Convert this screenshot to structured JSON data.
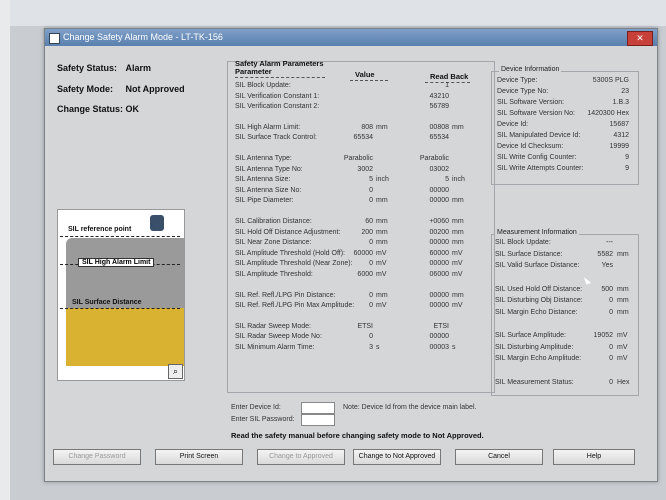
{
  "window": {
    "title": "Change Safety Alarm Mode - LT-TK-156",
    "close_icon": "close-icon"
  },
  "status": [
    {
      "label": "Safety Status:",
      "value": "Alarm"
    },
    {
      "label": "Safety Mode:",
      "value": "Not Approved"
    },
    {
      "label": "Change Status:",
      "value": "OK"
    }
  ],
  "diagram": {
    "ref_point": "SIL reference point",
    "high_alarm": "SIL High Alarm Limit",
    "surface_distance": "SIL Surface Distance",
    "icon": "magnifier-icon"
  },
  "params": {
    "group_title": "Safety Alarm Parameters",
    "col_param": "Parameter",
    "col_value": "Value",
    "col_readback": "Read Back",
    "rows": [
      {
        "p": "SIL Block Update:",
        "v": "",
        "u": "",
        "r": "1",
        "ru": ""
      },
      {
        "p": "SIL Verification Constant 1:",
        "v": "",
        "u": "",
        "r": "43210",
        "ru": ""
      },
      {
        "p": "SIL Verification Constant 2:",
        "v": "",
        "u": "",
        "r": "56789",
        "ru": ""
      },
      {
        "p": "SIL High Alarm Limit:",
        "v": "808",
        "u": "mm",
        "r": "00808",
        "ru": "mm"
      },
      {
        "p": "SIL Surface Track Control:",
        "v": "65534",
        "u": "",
        "r": "65534",
        "ru": ""
      },
      {
        "p": "SIL Antenna Type:",
        "v": "Parabolic",
        "u": "",
        "r": "Parabolic",
        "ru": ""
      },
      {
        "p": "SIL Antenna Type No:",
        "v": "3002",
        "u": "",
        "r": "03002",
        "ru": ""
      },
      {
        "p": "SIL Antenna Size:",
        "v": "5",
        "u": "inch",
        "r": "5",
        "ru": "inch"
      },
      {
        "p": "SIL Antenna Size No:",
        "v": "0",
        "u": "",
        "r": "00000",
        "ru": ""
      },
      {
        "p": "SIL Pipe Diameter:",
        "v": "0",
        "u": "mm",
        "r": "00000",
        "ru": "mm"
      },
      {
        "p": "SIL Calibration Distance:",
        "v": "60",
        "u": "mm",
        "r": "+0060",
        "ru": "mm"
      },
      {
        "p": "SIL Hold Off Distance Adjustment:",
        "v": "200",
        "u": "mm",
        "r": "00200",
        "ru": "mm"
      },
      {
        "p": "SIL Near Zone Distance:",
        "v": "0",
        "u": "mm",
        "r": "00000",
        "ru": "mm"
      },
      {
        "p": "SIL Amplitude Threshold (Hold Off):",
        "v": "60000",
        "u": "mV",
        "r": "60000",
        "ru": "mV"
      },
      {
        "p": "SIL Amplitude Threshold (Near Zone):",
        "v": "0",
        "u": "mV",
        "r": "00000",
        "ru": "mV"
      },
      {
        "p": "SIL Amplitude Threshold:",
        "v": "6000",
        "u": "mV",
        "r": "06000",
        "ru": "mV"
      },
      {
        "p": "SIL Ref. Refl./LPG Pin Distance:",
        "v": "0",
        "u": "mm",
        "r": "00000",
        "ru": "mm"
      },
      {
        "p": "SIL Ref. Refl./LPG Pin Max Amplitude:",
        "v": "0",
        "u": "mV",
        "r": "00000",
        "ru": "mV"
      },
      {
        "p": "SIL Radar Sweep Mode:",
        "v": "ETSI",
        "u": "",
        "r": "ETSI",
        "ru": ""
      },
      {
        "p": "SIL Radar Sweep Mode No:",
        "v": "0",
        "u": "",
        "r": "00000",
        "ru": ""
      },
      {
        "p": "SIL Minimum Alarm Time:",
        "v": "3",
        "u": "s",
        "r": "00003",
        "ru": "s"
      }
    ]
  },
  "device": {
    "group_title": "Device Information",
    "rows": [
      {
        "p": "Device Type:",
        "v": "5300S PLG"
      },
      {
        "p": "Device Type No:",
        "v": "23"
      },
      {
        "p": "SIL Software Version:",
        "v": "1.B.3"
      },
      {
        "p": "SIL Software Version No:",
        "v": "1420300 Hex"
      },
      {
        "p": "Device Id:",
        "v": "15687"
      },
      {
        "p": "SIL Manipulated Device Id:",
        "v": "4312"
      },
      {
        "p": "Device Id Checksum:",
        "v": "19999"
      },
      {
        "p": "SIL Write Config Counter:",
        "v": "9"
      },
      {
        "p": "SIL Write Attempts Counter:",
        "v": "9"
      }
    ]
  },
  "measurement": {
    "group_title": "Measurement Information",
    "rows": [
      {
        "p": "SIL Block Update:",
        "v": "---",
        "u": ""
      },
      {
        "p": "SIL Surface Distance:",
        "v": "5582",
        "u": "mm"
      },
      {
        "p": "SIL Valid Surface Distance:",
        "v": "Yes",
        "u": ""
      },
      {
        "p": "SIL Used Hold Off Distance:",
        "v": "500",
        "u": "mm"
      },
      {
        "p": "SIL Disturbing Obj Distance:",
        "v": "0",
        "u": "mm"
      },
      {
        "p": "SIL Margin Echo Distance:",
        "v": "0",
        "u": "mm"
      },
      {
        "p": "SIL Surface Amplitude:",
        "v": "19052",
        "u": "mV"
      },
      {
        "p": "SIL Disturbing Amplitude:",
        "v": "0",
        "u": "mV"
      },
      {
        "p": "SIL Margin Echo Amplitude:",
        "v": "0",
        "u": "mV"
      },
      {
        "p": "SIL Measurement Status:",
        "v": "0",
        "u": "Hex"
      }
    ]
  },
  "form": {
    "device_id_label": "Enter Device Id:",
    "password_label": "Enter SIL Password:",
    "note": "Note: Device Id from the device main label.",
    "warning": "Read the safety manual before changing safety mode to Not Approved."
  },
  "buttons": [
    {
      "label": "Change Password",
      "enabled": false
    },
    {
      "label": "Print Screen",
      "enabled": true
    },
    {
      "label": "Change to Approved",
      "enabled": false
    },
    {
      "label": "Change to Not Approved",
      "enabled": true
    },
    {
      "label": "Cancel",
      "enabled": true
    },
    {
      "label": "Help",
      "enabled": true
    }
  ]
}
